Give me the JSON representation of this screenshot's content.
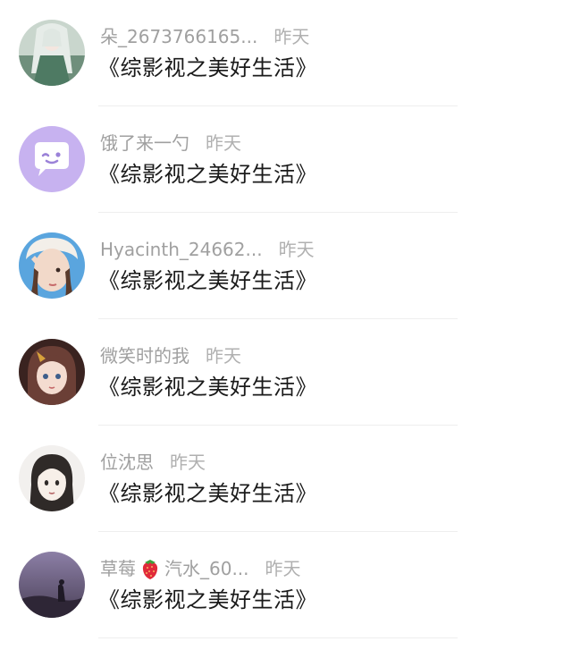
{
  "items": [
    {
      "name": "朵_2673766165...",
      "name_b": "",
      "time": "昨天",
      "title": "《综影视之美好生活》",
      "avatar": "anime-girl-green-dress-avatar"
    },
    {
      "name": "饿了来一勺",
      "name_b": "",
      "time": "昨天",
      "title": "《综影视之美好生活》",
      "avatar": "purple-chat-bubble-face-avatar"
    },
    {
      "name": "Hyacinth_24662...",
      "name_b": "",
      "time": "昨天",
      "title": "《综影视之美好生活》",
      "avatar": "girl-fur-hat-avatar"
    },
    {
      "name": "微笑时的我",
      "name_b": "",
      "time": "昨天",
      "title": "《综影视之美好生活》",
      "avatar": "anime-girl-dark-hair-avatar"
    },
    {
      "name": "位沈思",
      "name_b": "",
      "time": "昨天",
      "title": "《综影视之美好生活》",
      "avatar": "cartoon-girl-sketch-avatar"
    },
    {
      "name": "草莓",
      "name_b": "汽水_60...",
      "time": "昨天",
      "title": "《综影视之美好生活》",
      "avatar": "purple-sky-silhouette-avatar",
      "emoji": "strawberry-icon"
    }
  ]
}
